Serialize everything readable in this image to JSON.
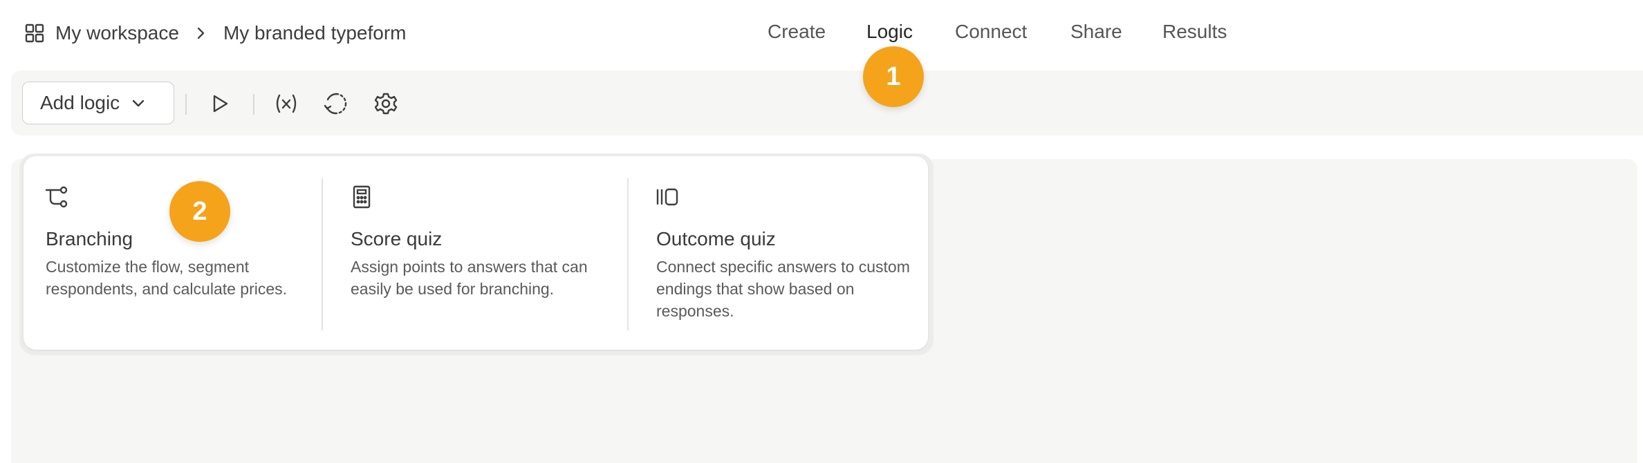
{
  "header": {
    "breadcrumb": [
      "My workspace",
      "My branded typeform"
    ],
    "icons": {
      "workspace": "grid-icon",
      "separator": "chevron-right-icon"
    }
  },
  "nav": {
    "tabs": [
      {
        "label": "Create"
      },
      {
        "label": "Logic",
        "active": true
      },
      {
        "label": "Connect"
      },
      {
        "label": "Share"
      },
      {
        "label": "Results"
      }
    ]
  },
  "badges": [
    "1",
    "2"
  ],
  "toolbar": {
    "add_logic_label": "Add logic",
    "icons": [
      "play-icon",
      "variable-icon",
      "logic-map-icon",
      "settings-icon"
    ]
  },
  "logic_menu": {
    "options": [
      {
        "icon": "branching-icon",
        "title": "Branching",
        "description": "Customize the flow, segment respondents, and calculate prices."
      },
      {
        "icon": "calculator-icon",
        "title": "Score quiz",
        "description": "Assign points to answers that can easily be used for branching."
      },
      {
        "icon": "outcome-icon",
        "title": "Outcome quiz",
        "description": "Connect specific answers to custom endings that show based on responses."
      }
    ]
  },
  "colors": {
    "badge": "#f5a31a",
    "surface": "#f6f6f4",
    "text": "#3a3a3a"
  }
}
